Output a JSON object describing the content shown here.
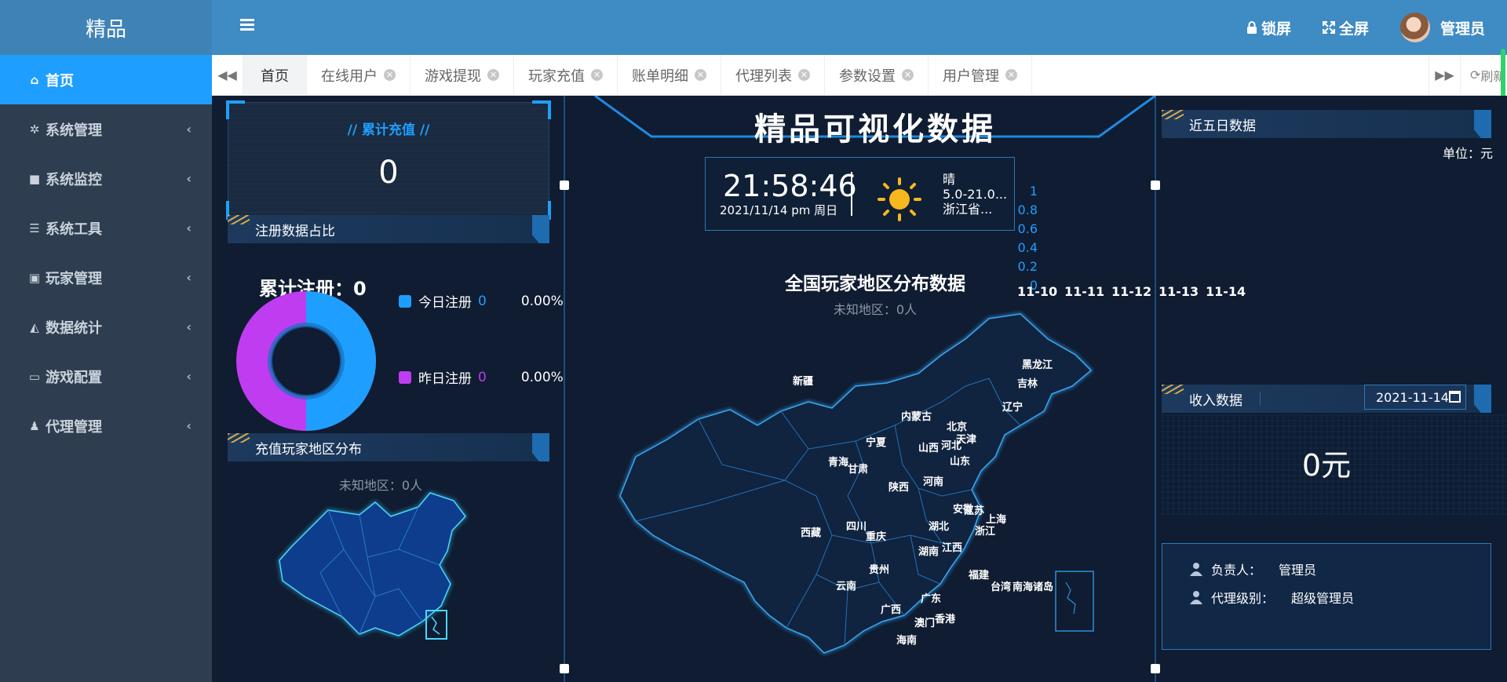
{
  "brand": "精品",
  "sidebar": {
    "items": [
      {
        "icon": "home-icon",
        "glyph": "⌂",
        "label": "首页"
      },
      {
        "icon": "gear-icon",
        "glyph": "✲",
        "label": "系统管理"
      },
      {
        "icon": "video-icon",
        "glyph": "■",
        "label": "系统监控"
      },
      {
        "icon": "list-icon",
        "glyph": "☰",
        "label": "系统工具"
      },
      {
        "icon": "user-card-icon",
        "glyph": "▣",
        "label": "玩家管理"
      },
      {
        "icon": "area-chart-icon",
        "glyph": "◭",
        "label": "数据统计"
      },
      {
        "icon": "monitor-icon",
        "glyph": "▭",
        "label": "游戏配置"
      },
      {
        "icon": "users-icon",
        "glyph": "♟",
        "label": "代理管理"
      }
    ]
  },
  "header": {
    "lock": "锁屏",
    "fullscreen": "全屏",
    "user": "管理员"
  },
  "tabs": [
    {
      "label": "首页",
      "closable": false
    },
    {
      "label": "在线用户",
      "closable": true
    },
    {
      "label": "游戏提现",
      "closable": true
    },
    {
      "label": "玩家充值",
      "closable": true
    },
    {
      "label": "账单明细",
      "closable": true
    },
    {
      "label": "代理列表",
      "closable": true
    },
    {
      "label": "参数设置",
      "closable": true
    },
    {
      "label": "用户管理",
      "closable": true
    }
  ],
  "tabbar": {
    "refresh": "刷新"
  },
  "dashboard": {
    "title": "精品可视化数据",
    "recharge": {
      "title": "//   累计充值   //",
      "value": "0"
    },
    "register": {
      "header": "注册数据占比",
      "total_label": "累计注册：0",
      "today_label": "今日注册",
      "today_count": "0",
      "today_pct": "0.00%",
      "yesterday_label": "昨日注册",
      "yesterday_count": "0",
      "yesterday_pct": "0.00%"
    },
    "recharge_region": {
      "header": "充值玩家地区分布",
      "unknown": "未知地区：0人"
    },
    "clock": {
      "time": "21:58:46",
      "date": "2021/11/14   pm   周日"
    },
    "weather": {
      "condition": "晴",
      "temp": "5.0-21.0...",
      "location": "浙江省..."
    },
    "map": {
      "title": "全国玩家地区分布数据",
      "unknown": "未知地区：0人",
      "provinces": [
        "新疆",
        "西藏",
        "青海",
        "甘肃",
        "宁夏",
        "内蒙古",
        "黑龙江",
        "吉林",
        "辽宁",
        "北京",
        "天津",
        "河北",
        "山西",
        "山东",
        "河南",
        "陕西",
        "四川",
        "重庆",
        "湖北",
        "安徽",
        "江苏",
        "上海",
        "浙江",
        "湖南",
        "江西",
        "福建",
        "台湾",
        "南海诸岛",
        "贵州",
        "云南",
        "广西",
        "广东",
        "澳门",
        "香港",
        "海南"
      ]
    },
    "five_day": {
      "header": "近五日数据",
      "unit": "单位：元"
    },
    "income": {
      "header": "收入数据",
      "date": "2021-11-14",
      "value": "0元"
    },
    "info": {
      "owner_label": "负责人：",
      "owner": "管理员",
      "level_label": "代理级别：",
      "level": "超级管理员"
    }
  },
  "chart_data": {
    "type": "bar",
    "categories": [
      "11-10",
      "11-11",
      "11-12",
      "11-13",
      "11-14"
    ],
    "values": [
      0,
      0,
      0,
      0,
      0
    ],
    "y_ticks": [
      "1",
      "0.8",
      "0.6",
      "0.4",
      "0.2",
      "0"
    ],
    "ylim": [
      0,
      1
    ],
    "colors": {
      "axis": "#1e9fff"
    }
  },
  "colors": {
    "accent": "#1e9fff",
    "header": "#3f8bc3",
    "sidebar": "#2e3d4f",
    "today": "#1e9fff",
    "yesterday": "#c03cf0"
  }
}
